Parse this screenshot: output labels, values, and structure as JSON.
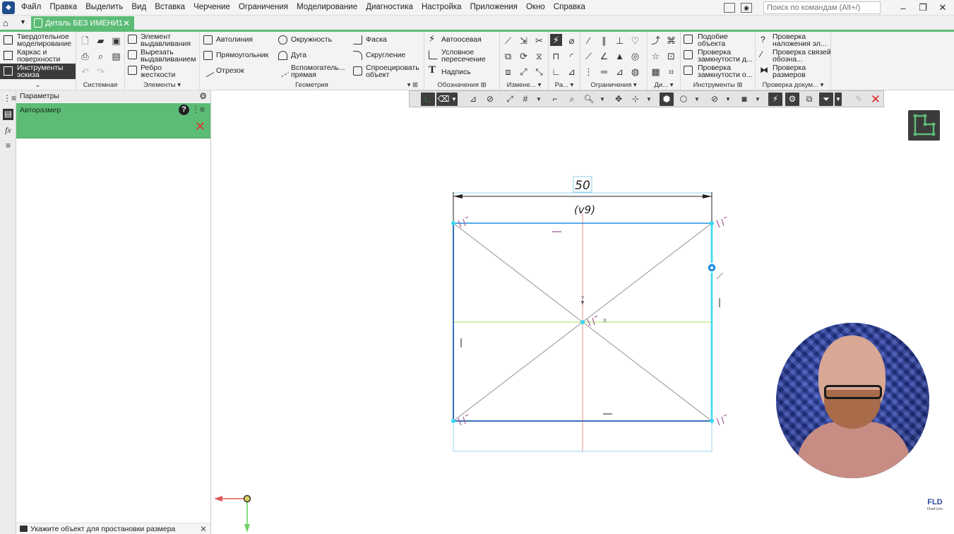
{
  "menu": {
    "items": [
      "Файл",
      "Правка",
      "Выделить",
      "Вид",
      "Вставка",
      "Черчение",
      "Ограничения",
      "Моделирование",
      "Диагностика",
      "Настройка",
      "Приложения",
      "Окно",
      "Справка"
    ],
    "search_placeholder": "Поиск по командам (Alt+/)",
    "minimize": "–",
    "restore": "❐",
    "close": "✕"
  },
  "tab": {
    "doc_title": "Деталь БЕЗ ИМЕНИ1",
    "close": "✕"
  },
  "ribbon": {
    "modes": [
      "Твердотельное моделирование",
      "Каркас и поверхности",
      "Инструменты эскиза"
    ],
    "groups": {
      "system": "Системная",
      "elements": "Элементы",
      "geometry": "Геометрия",
      "designations": "Обозначения",
      "changes": "Измене...",
      "dimensions": "Ра...",
      "constraints": "Ограничения",
      "diagnostics": "Ди...",
      "tools": "Инструменты",
      "doc_check": "Проверка докум..."
    },
    "elements_buttons": [
      "Элемент выдавливания",
      "Вырезать выдавливанием",
      "Ребро жесткости"
    ],
    "geometry_buttons": [
      "Автолиния",
      "Окружность",
      "Фаска",
      "Прямоугольник",
      "Дуга",
      "Скругление",
      "Отрезок",
      "Вспомогатель... прямая",
      "Спроецировать объект"
    ],
    "designations_buttons": [
      "Автоосевая",
      "Условное пересечение",
      "Надпись"
    ],
    "tools_buttons": [
      "Подобие объекта",
      "Проверка замкнутости д...",
      "Проверка замкнутости о..."
    ],
    "doc_check_buttons": [
      "Проверка наложения эл...",
      "Проверка связей обозна...",
      "Проверка размеров"
    ]
  },
  "panel": {
    "header": "Параметры",
    "command": "Авторазмер",
    "help": "?",
    "cancel": "✕",
    "status_hint": "Укажите объект для простановки размера",
    "status_close": "✕"
  },
  "sketch": {
    "dimension_value": "50",
    "dimension_variable": "(v9)"
  },
  "brand": {
    "logo_text": "FLD",
    "logo_sub": "Fluid-Line"
  },
  "colors": {
    "accent_green": "#5cbc76",
    "sketch_blue": "#1e90e0",
    "axis_red": "#e05858",
    "axis_green": "#9ee04a",
    "cancel_red": "#e02828"
  }
}
